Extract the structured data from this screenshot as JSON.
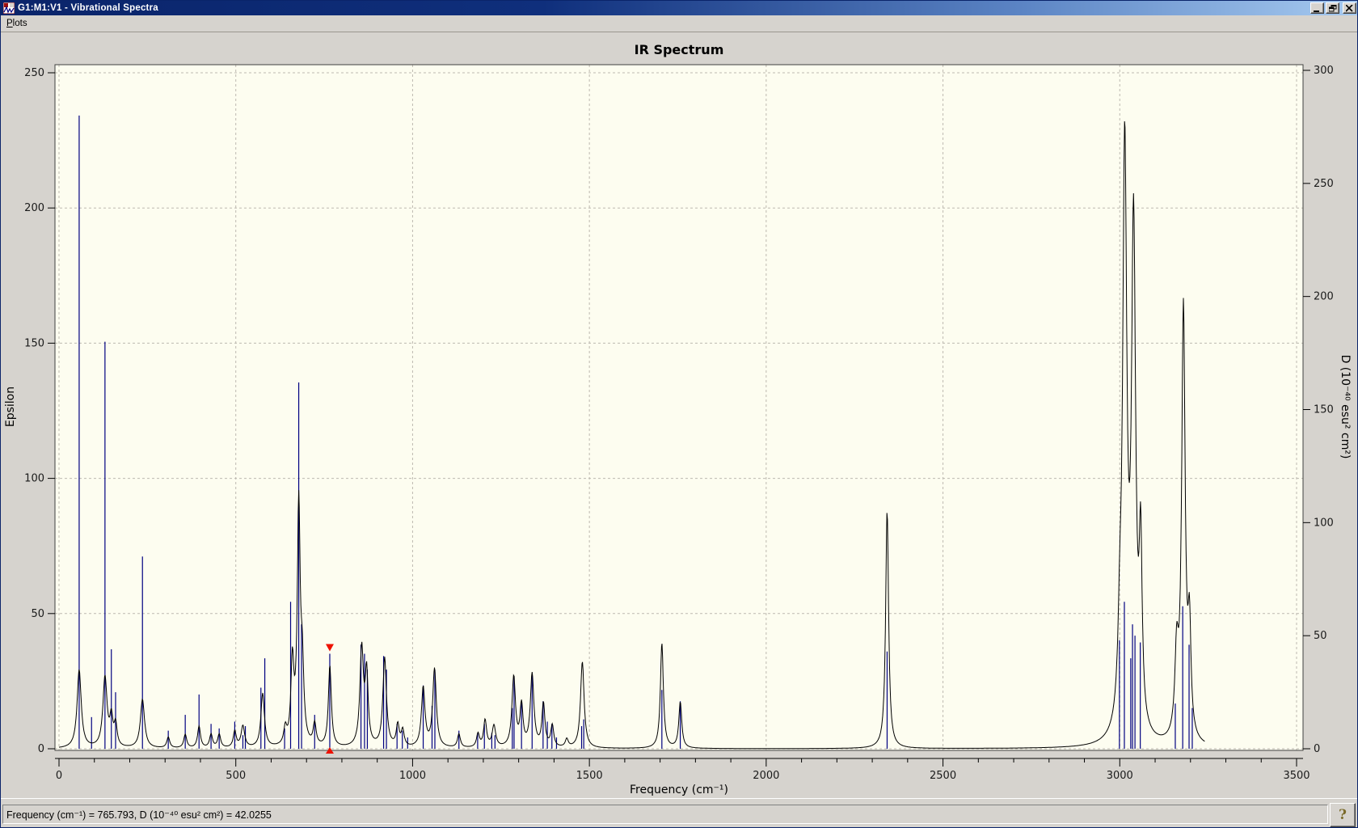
{
  "window": {
    "title": "G1:M1:V1 - Vibrational Spectra",
    "icon": "vibrational-spectra-app-icon",
    "controls": {
      "minimize": "minimize",
      "restore": "restore",
      "close": "close"
    }
  },
  "menu_bar": {
    "items": [
      {
        "label": "Plots",
        "accelerator": "P",
        "rest": "lots"
      }
    ]
  },
  "status_bar": {
    "text": "Frequency (cm⁻¹) = 765.793, D (10⁻⁴⁰ esu² cm²) = 42.0255",
    "help_label": "?"
  },
  "colors": {
    "titlebar_left": "#0a246a",
    "titlebar_right": "#a6caf0",
    "chrome": "#d6d3ce",
    "plot_background": "#fdfdf0",
    "grid": "#bdb9b0",
    "stick": "#000080",
    "envelope": "#000000",
    "marker": "#ee1100",
    "frame": "#404040",
    "tick_text": "#1a1a1a"
  },
  "chart_data": {
    "type": "stick+line",
    "title": "IR Spectrum",
    "xlabel": "Frequency (cm⁻¹)",
    "ylabel_left": "Epsilon",
    "ylabel_right": "D (10⁻⁴⁰ esu² cm²)",
    "x_range": [
      0,
      3500
    ],
    "epsilon_range": [
      0,
      250
    ],
    "d_range": [
      0,
      300
    ],
    "x_major_ticks": [
      0,
      500,
      1000,
      1500,
      2000,
      2500,
      3000,
      3500
    ],
    "x_minor_step": 100,
    "epsilon_ticks": [
      0,
      50,
      100,
      150,
      200,
      250
    ],
    "d_ticks": [
      0,
      50,
      100,
      150,
      200,
      250,
      300
    ],
    "grid": "dashed, vertical at x major ticks, horizontal at epsilon ticks",
    "legend": "none",
    "selected_peak": {
      "frequency": 765.793,
      "d": 42.0255
    },
    "sticks_axis": "right (D)",
    "sticks": [
      [
        57,
        280
      ],
      [
        92,
        14
      ],
      [
        130,
        180
      ],
      [
        148,
        44
      ],
      [
        160,
        25
      ],
      [
        236,
        85
      ],
      [
        309,
        8
      ],
      [
        357,
        15
      ],
      [
        396,
        24
      ],
      [
        430,
        11
      ],
      [
        453,
        9
      ],
      [
        497,
        12
      ],
      [
        520,
        6
      ],
      [
        527,
        10
      ],
      [
        571,
        27
      ],
      [
        582,
        40
      ],
      [
        638,
        9
      ],
      [
        655,
        65
      ],
      [
        678,
        162
      ],
      [
        686,
        55
      ],
      [
        723,
        15
      ],
      [
        765.793,
        42.0255
      ],
      [
        854,
        46
      ],
      [
        864,
        42
      ],
      [
        872,
        35
      ],
      [
        918,
        41
      ],
      [
        926,
        35
      ],
      [
        956,
        11
      ],
      [
        971,
        8
      ],
      [
        986,
        5
      ],
      [
        1030,
        28
      ],
      [
        1055,
        19
      ],
      [
        1063,
        35
      ],
      [
        1131,
        8
      ],
      [
        1184,
        7
      ],
      [
        1203,
        11
      ],
      [
        1224,
        7
      ],
      [
        1233,
        6
      ],
      [
        1282,
        18
      ],
      [
        1287,
        32
      ],
      [
        1308,
        21
      ],
      [
        1338,
        33
      ],
      [
        1369,
        21
      ],
      [
        1381,
        12
      ],
      [
        1394,
        11
      ],
      [
        1407,
        5
      ],
      [
        1478,
        10
      ],
      [
        1484,
        13
      ],
      [
        1705,
        26
      ],
      [
        1757,
        21
      ],
      [
        2342,
        43
      ],
      [
        2999,
        48
      ],
      [
        3013,
        65
      ],
      [
        3031,
        40
      ],
      [
        3036,
        55
      ],
      [
        3043,
        50
      ],
      [
        3058,
        47
      ],
      [
        3157,
        20
      ],
      [
        3178,
        63
      ],
      [
        3196,
        46
      ],
      [
        3205,
        18
      ]
    ],
    "envelope_axis": "left (Epsilon)",
    "envelope_peaks": [
      [
        57,
        29,
        7
      ],
      [
        130,
        26,
        7
      ],
      [
        148,
        10,
        5
      ],
      [
        160,
        8,
        5
      ],
      [
        236,
        18,
        7
      ],
      [
        309,
        4,
        5
      ],
      [
        357,
        5,
        5
      ],
      [
        396,
        8,
        5
      ],
      [
        430,
        5,
        5
      ],
      [
        453,
        5,
        5
      ],
      [
        497,
        6,
        5
      ],
      [
        520,
        8,
        6
      ],
      [
        576,
        20,
        6
      ],
      [
        640,
        6,
        5
      ],
      [
        660,
        30,
        5
      ],
      [
        678,
        88,
        5
      ],
      [
        688,
        25,
        5
      ],
      [
        723,
        8,
        5
      ],
      [
        766,
        30,
        5
      ],
      [
        856,
        36,
        6
      ],
      [
        870,
        26,
        5
      ],
      [
        921,
        33,
        6
      ],
      [
        958,
        8,
        5
      ],
      [
        972,
        6,
        5
      ],
      [
        1030,
        22,
        6
      ],
      [
        1062,
        29,
        6
      ],
      [
        1131,
        5,
        5
      ],
      [
        1185,
        5,
        5
      ],
      [
        1205,
        10,
        5
      ],
      [
        1230,
        8,
        6
      ],
      [
        1286,
        26,
        6
      ],
      [
        1308,
        15,
        5
      ],
      [
        1338,
        27,
        6
      ],
      [
        1370,
        16,
        5
      ],
      [
        1395,
        8,
        5
      ],
      [
        1436,
        3,
        5
      ],
      [
        1480,
        32,
        6
      ],
      [
        1705,
        39,
        5
      ],
      [
        1757,
        17,
        5
      ],
      [
        2342,
        88,
        5
      ],
      [
        3000,
        25,
        6
      ],
      [
        3014,
        215,
        7
      ],
      [
        3039,
        185,
        7
      ],
      [
        3059,
        65,
        5
      ],
      [
        3161,
        30,
        6
      ],
      [
        3180,
        160,
        6
      ],
      [
        3197,
        38,
        5
      ]
    ],
    "envelope_end_frequency": 3240
  }
}
